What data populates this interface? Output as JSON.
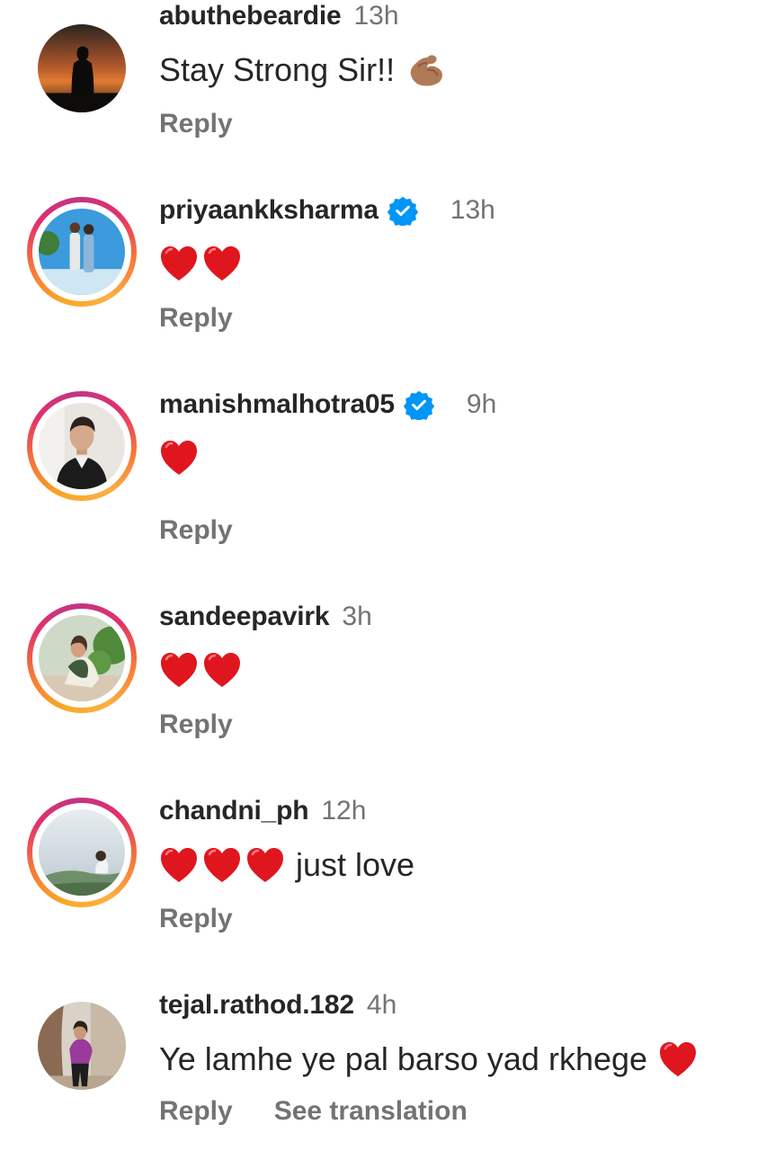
{
  "comments": [
    {
      "username": "abuthebeardie",
      "time": "13h",
      "text": "Stay Strong Sir!!",
      "emoji": "flexed-biceps",
      "reply": "Reply",
      "verified": false,
      "story_ring": false
    },
    {
      "username": "priyaankksharma",
      "time": "13h",
      "text": "",
      "hearts": 2,
      "reply": "Reply",
      "verified": true,
      "story_ring": true
    },
    {
      "username": "manishmalhotra05",
      "time": "9h",
      "text": "",
      "hearts": 1,
      "reply": "Reply",
      "verified": true,
      "story_ring": true
    },
    {
      "username": "sandeepavirk",
      "time": "3h",
      "text": "",
      "hearts": 2,
      "reply": "Reply",
      "verified": false,
      "story_ring": true
    },
    {
      "username": "chandni_ph",
      "time": "12h",
      "text": "just love",
      "hearts": 3,
      "reply": "Reply",
      "verified": false,
      "story_ring": true
    },
    {
      "username": "tejal.rathod.182",
      "time": "4h",
      "text": "Ye lamhe ye pal barso yad rkhege",
      "hearts_after": 1,
      "reply": "Reply",
      "see_translation": "See translation",
      "verified": false,
      "story_ring": false
    }
  ],
  "colors": {
    "username": "#262626",
    "meta": "#737373",
    "verified": "#0095f6",
    "heart": "#e0161e"
  }
}
